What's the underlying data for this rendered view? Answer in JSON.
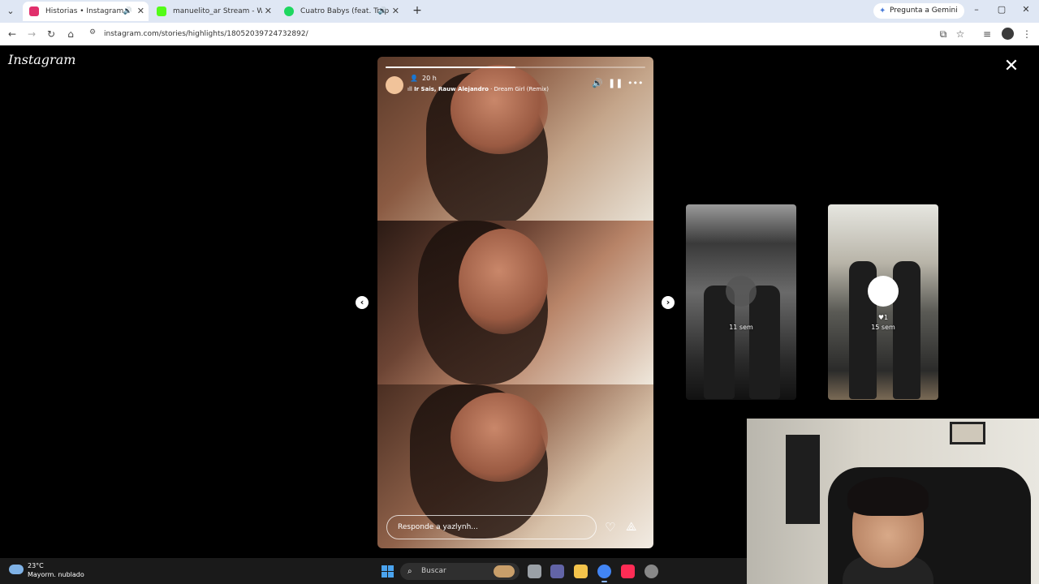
{
  "browser": {
    "tabs": [
      {
        "title": "Historias • Instagram",
        "active": true,
        "favicon_color": "#e1306c",
        "has_audio": true
      },
      {
        "title": "manuelito_ar Stream - Watch Li",
        "active": false,
        "favicon_color": "#53fc18",
        "has_audio": false
      },
      {
        "title": "Cuatro Babys (feat. Trap Cap",
        "active": false,
        "favicon_color": "#1ed760",
        "has_audio": true
      }
    ],
    "gemini_label": "Pregunta a Gemini",
    "url": "instagram.com/stories/highlights/18052039724732892/"
  },
  "instagram": {
    "logo": "Instagram",
    "story": {
      "progress_fraction": 0.5,
      "time": "20 h",
      "song_artists": "Ir Sais, Rauw Alejandro",
      "song_title": "Dream Girl (Remix)",
      "reply_placeholder": "Responde a yazlynh..."
    },
    "previews": [
      {
        "likes": "",
        "age": "11 sem"
      },
      {
        "likes": "1",
        "age": "15 sem"
      }
    ]
  },
  "taskbar": {
    "temperature": "23°C",
    "weather": "Mayorm. nublado",
    "search_placeholder": "Buscar",
    "apps": [
      {
        "name": "task-view",
        "color": "#9aa0a6"
      },
      {
        "name": "teams",
        "color": "#6264a7"
      },
      {
        "name": "file-explorer",
        "color": "#f3c34b"
      },
      {
        "name": "chrome",
        "color": "#4285f4",
        "active": true
      },
      {
        "name": "tiktok",
        "color": "#fe2c55"
      },
      {
        "name": "app-extra",
        "color": "#888888"
      }
    ]
  },
  "colors": {
    "chrome_tabstrip": "#dfe7f4",
    "ig_background": "#000000",
    "taskbar": "#1a1a1a"
  }
}
